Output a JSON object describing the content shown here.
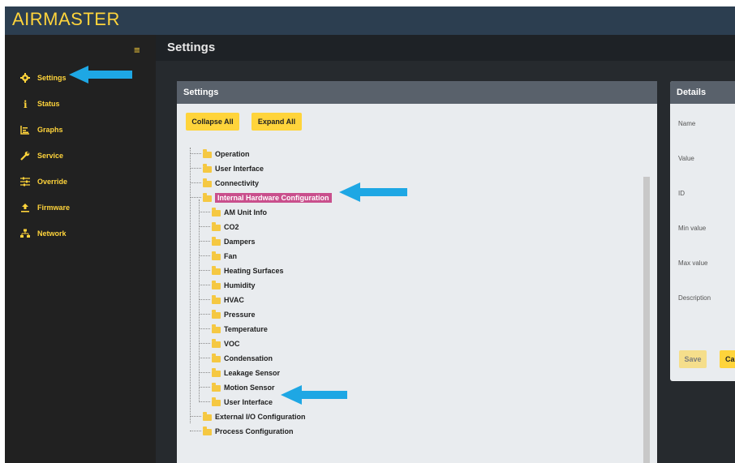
{
  "app": {
    "brand": "AIRMASTER"
  },
  "page": {
    "title": "Settings"
  },
  "sidebar": {
    "menu_icon": "hamburger-icon",
    "items": [
      {
        "label": "Settings",
        "icon": "gear-icon"
      },
      {
        "label": "Status",
        "icon": "info-icon"
      },
      {
        "label": "Graphs",
        "icon": "chart-icon"
      },
      {
        "label": "Service",
        "icon": "wrench-icon"
      },
      {
        "label": "Override",
        "icon": "sliders-icon"
      },
      {
        "label": "Firmware",
        "icon": "upload-icon"
      },
      {
        "label": "Network",
        "icon": "network-icon"
      }
    ]
  },
  "settings_panel": {
    "title": "Settings",
    "collapse_all": "Collapse All",
    "expand_all": "Expand All",
    "tree": {
      "top_before": [
        "Operation",
        "User Interface",
        "Connectivity"
      ],
      "expanded": "Internal Hardware Configuration",
      "children": [
        "AM Unit Info",
        "CO2",
        "Dampers",
        "Fan",
        "Heating Surfaces",
        "Humidity",
        "HVAC",
        "Pressure",
        "Temperature",
        "VOC",
        "Condensation",
        "Leakage Sensor",
        "Motion Sensor",
        "User Interface"
      ],
      "top_after": [
        "External I/O Configuration",
        "Process Configuration"
      ]
    }
  },
  "details_panel": {
    "title": "Details",
    "fields": [
      "Name",
      "Value",
      "ID",
      "Min value",
      "Max value",
      "Description"
    ],
    "save": "Save",
    "cancel": "Ca"
  },
  "colors": {
    "accent": "#ffd43b",
    "selected": "#c94f8c",
    "annotation_arrow": "#1ea7e4"
  }
}
